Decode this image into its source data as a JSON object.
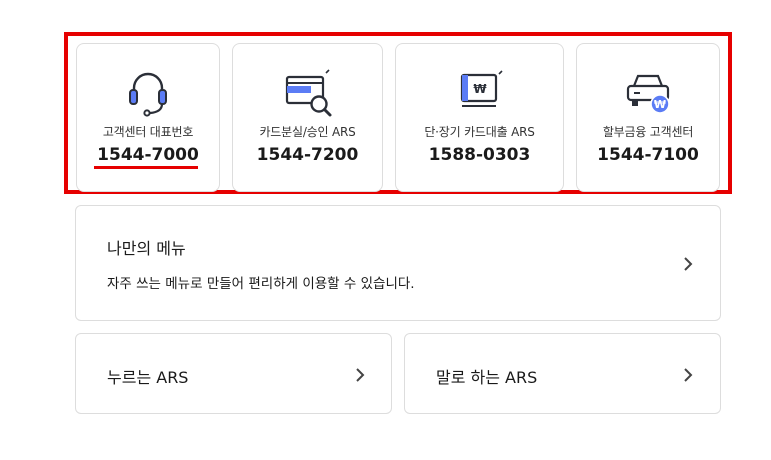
{
  "contacts": [
    {
      "label": "고객센터 대표번호",
      "number": "1544-7000",
      "icon": "headset-icon"
    },
    {
      "label": "카드분실/승인 ARS",
      "number": "1544-7200",
      "icon": "card-search-icon"
    },
    {
      "label": "단·장기 카드대출 ARS",
      "number": "1588-0303",
      "icon": "loan-card-won-icon"
    },
    {
      "label": "할부금융 고객센터",
      "number": "1544-7100",
      "icon": "car-won-icon"
    }
  ],
  "my_menu": {
    "title": "나만의 메뉴",
    "description": "자주 쓰는 메뉴로 만들어 편리하게 이용할 수 있습니다."
  },
  "ars_buttons": {
    "press": "누르는 ARS",
    "voice": "말로 하는 ARS"
  },
  "colors": {
    "highlight": "#e60000",
    "icon_accent": "#5b7cf5",
    "icon_dark": "#2b2f38",
    "border": "#dddddd"
  }
}
